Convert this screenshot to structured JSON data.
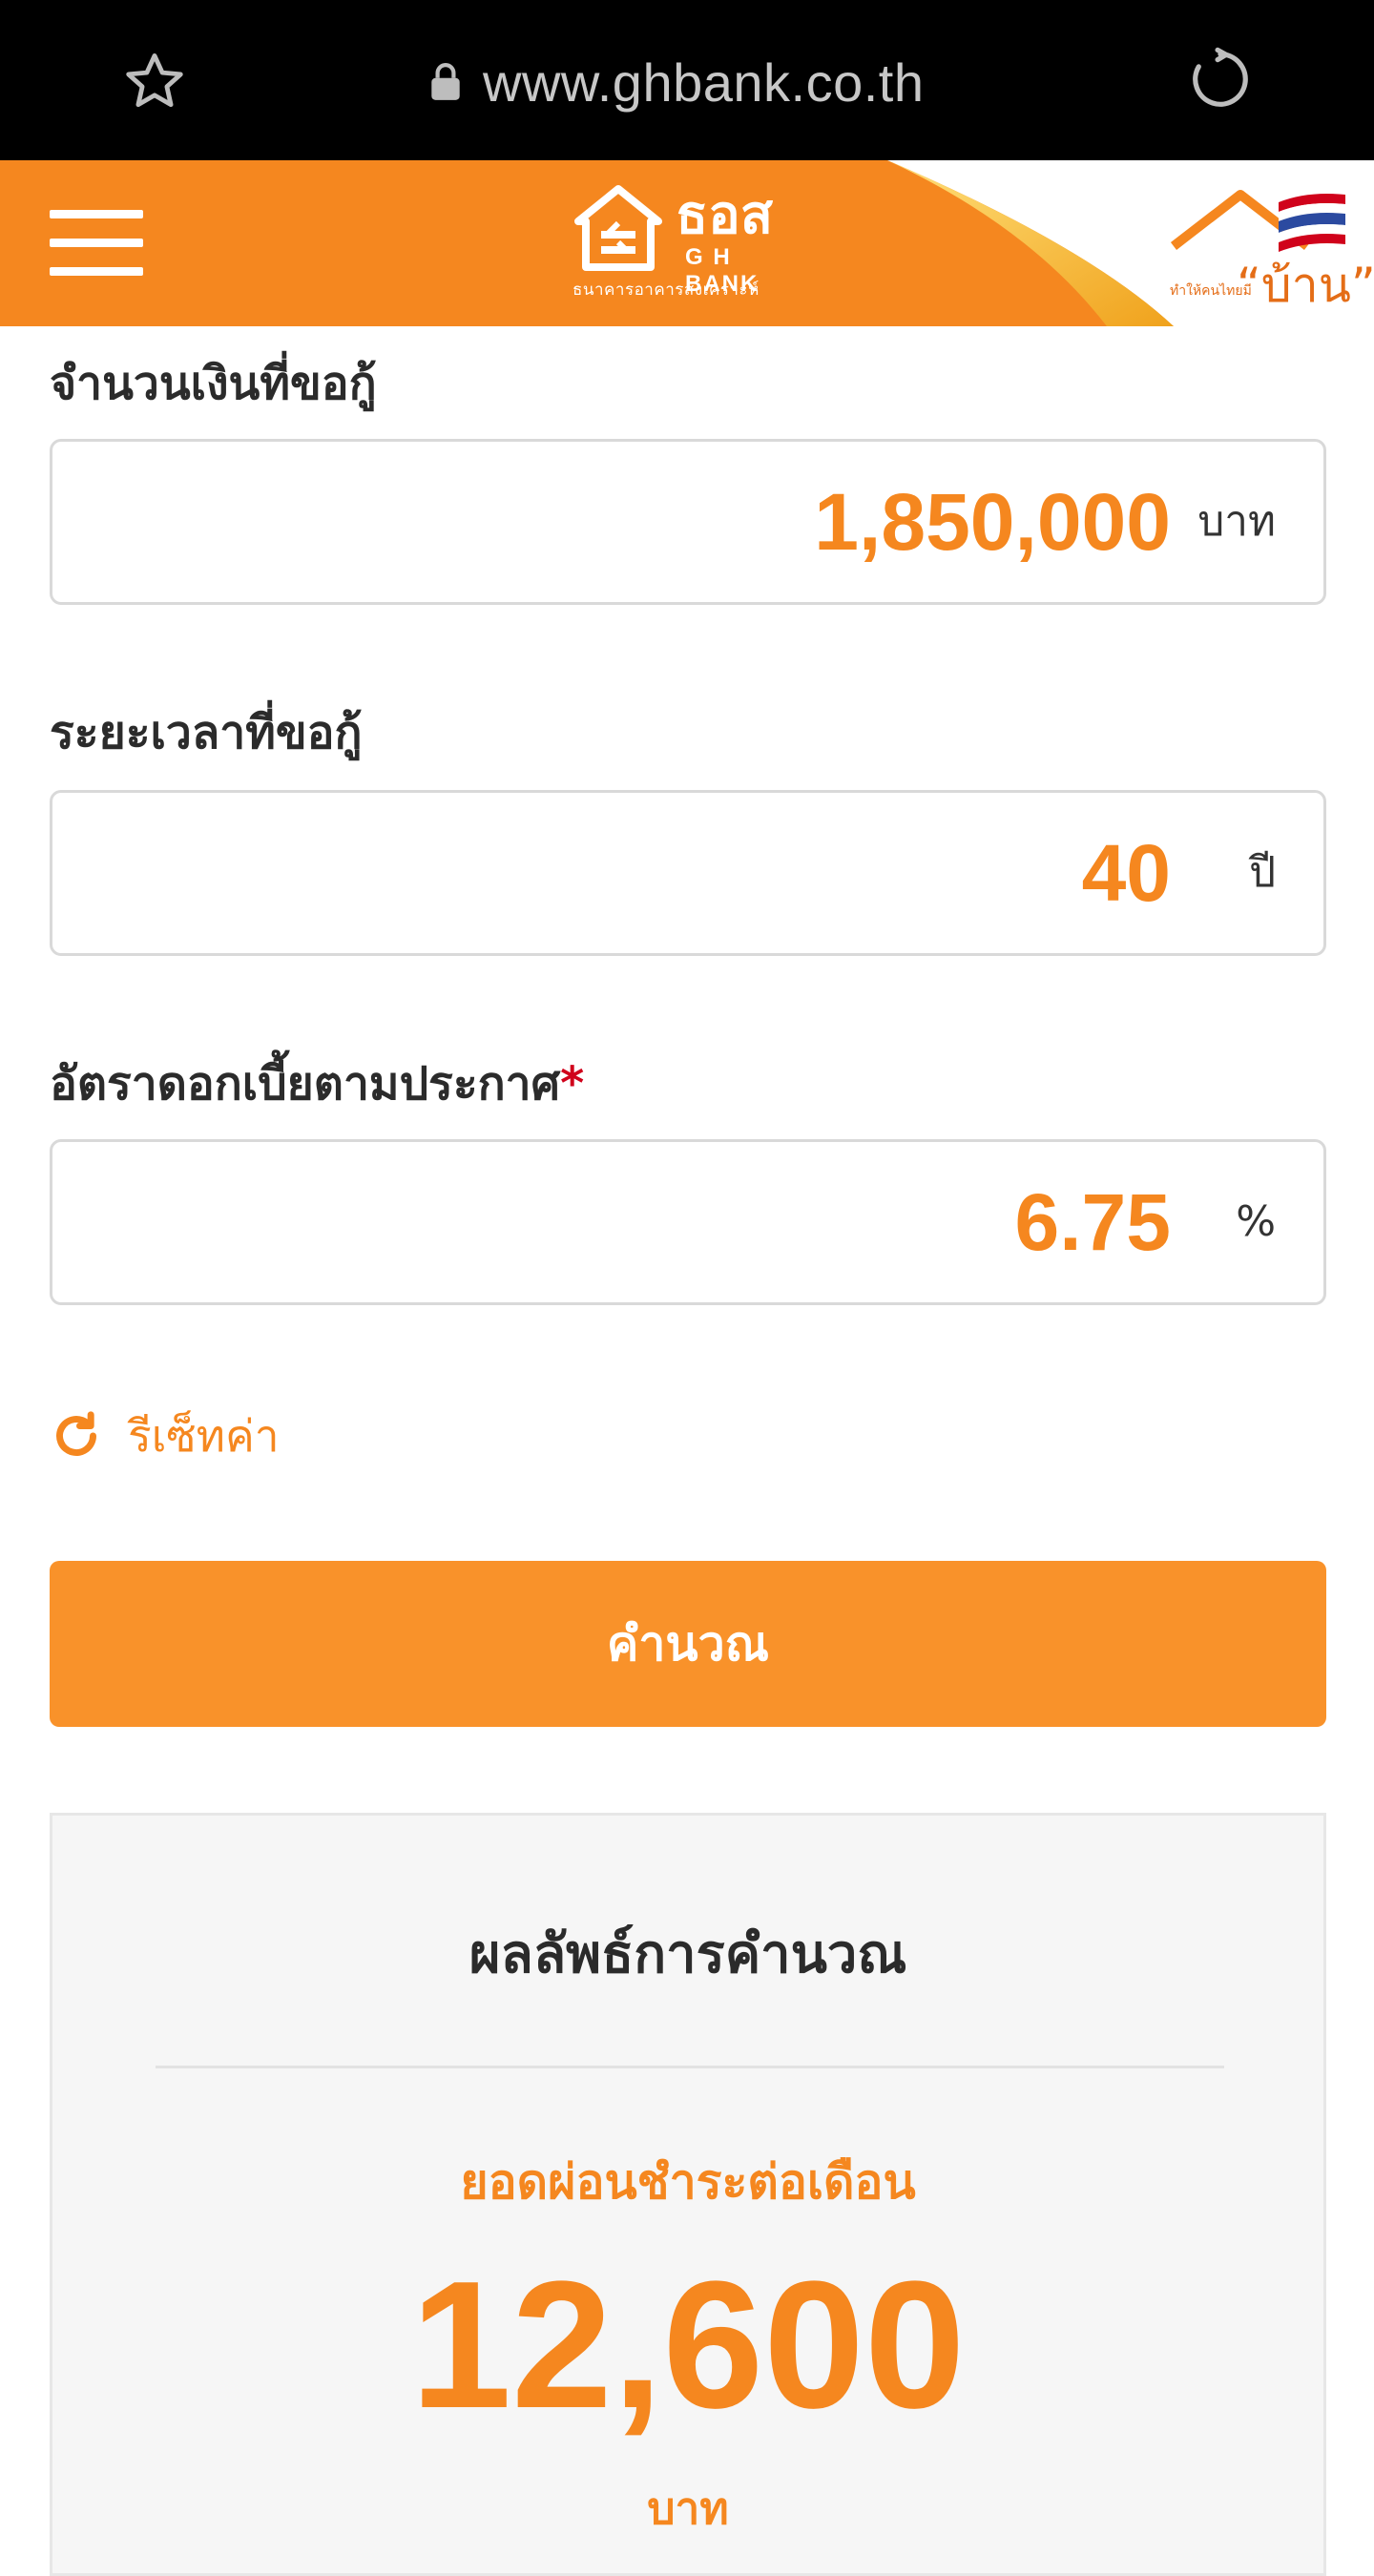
{
  "browser": {
    "url": "www.ghbank.co.th",
    "icons": {
      "bookmark": "star-icon",
      "secure": "lock-icon",
      "reload": "reload-icon"
    }
  },
  "header": {
    "logo": {
      "main": "ธอส",
      "sub": "G H BANK",
      "thai_name": "ธนาคารอาคารสงเคราะห์"
    },
    "campaign": {
      "tagline": "ทำให้คนไทยมี",
      "word": "“บ้าน”"
    },
    "colors": {
      "brand": "#f5871f",
      "white": "#ffffff"
    }
  },
  "form": {
    "loan_amount": {
      "label": "จำนวนเงินที่ขอกู้",
      "value": "1,850,000",
      "unit": "บาท"
    },
    "loan_term": {
      "label": "ระยะเวลาที่ขอกู้",
      "value": "40",
      "unit": "ปี"
    },
    "interest_rate": {
      "label": "อัตราดอกเบี้ยตามประกาศ",
      "required_mark": "*",
      "value": "6.75",
      "unit": "%"
    },
    "reset_label": "รีเซ็ทค่า",
    "calculate_label": "คำนวณ"
  },
  "result": {
    "title": "ผลลัพธ์การคำนวณ",
    "monthly_label": "ยอดผ่อนชำระต่อเดือน",
    "monthly_value": "12,600",
    "monthly_unit": "บาท"
  }
}
